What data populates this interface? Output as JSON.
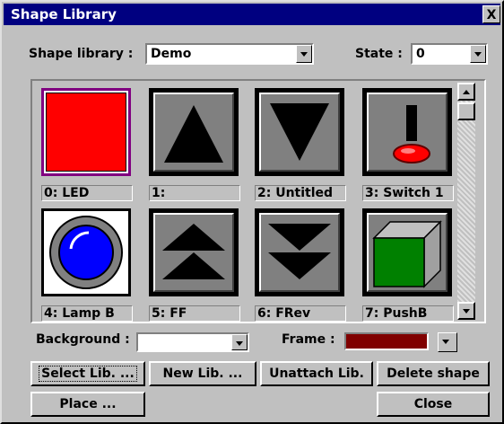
{
  "window": {
    "title": "Shape Library",
    "close_label": "X"
  },
  "library": {
    "label": "Shape library :",
    "value": "Demo"
  },
  "state": {
    "label": "State :",
    "value": "0"
  },
  "shapes": [
    {
      "caption": "0: LED",
      "icon": "led-icon",
      "color": "#ff0000"
    },
    {
      "caption": "1:",
      "icon": "triangle-up-icon"
    },
    {
      "caption": "2: Untitled",
      "icon": "triangle-down-icon"
    },
    {
      "caption": "3: Switch 1",
      "icon": "toggle-switch-icon"
    },
    {
      "caption": "4: Lamp B",
      "icon": "lamp-icon",
      "color": "#0000ff"
    },
    {
      "caption": "5: FF",
      "icon": "fast-forward-icon"
    },
    {
      "caption": "6: FRev",
      "icon": "fast-reverse-icon"
    },
    {
      "caption": "7: PushB",
      "icon": "push-button-icon",
      "color": "#008000"
    }
  ],
  "background": {
    "label": "Background :",
    "color": "#ffffff"
  },
  "frame": {
    "label": "Frame :",
    "color": "#800000"
  },
  "buttons": {
    "select_lib": "Select Lib. ...",
    "new_lib": "New Lib. ...",
    "unattach_lib": "Unattach Lib.",
    "delete_shape": "Delete shape",
    "place": "Place ...",
    "close": "Close"
  }
}
